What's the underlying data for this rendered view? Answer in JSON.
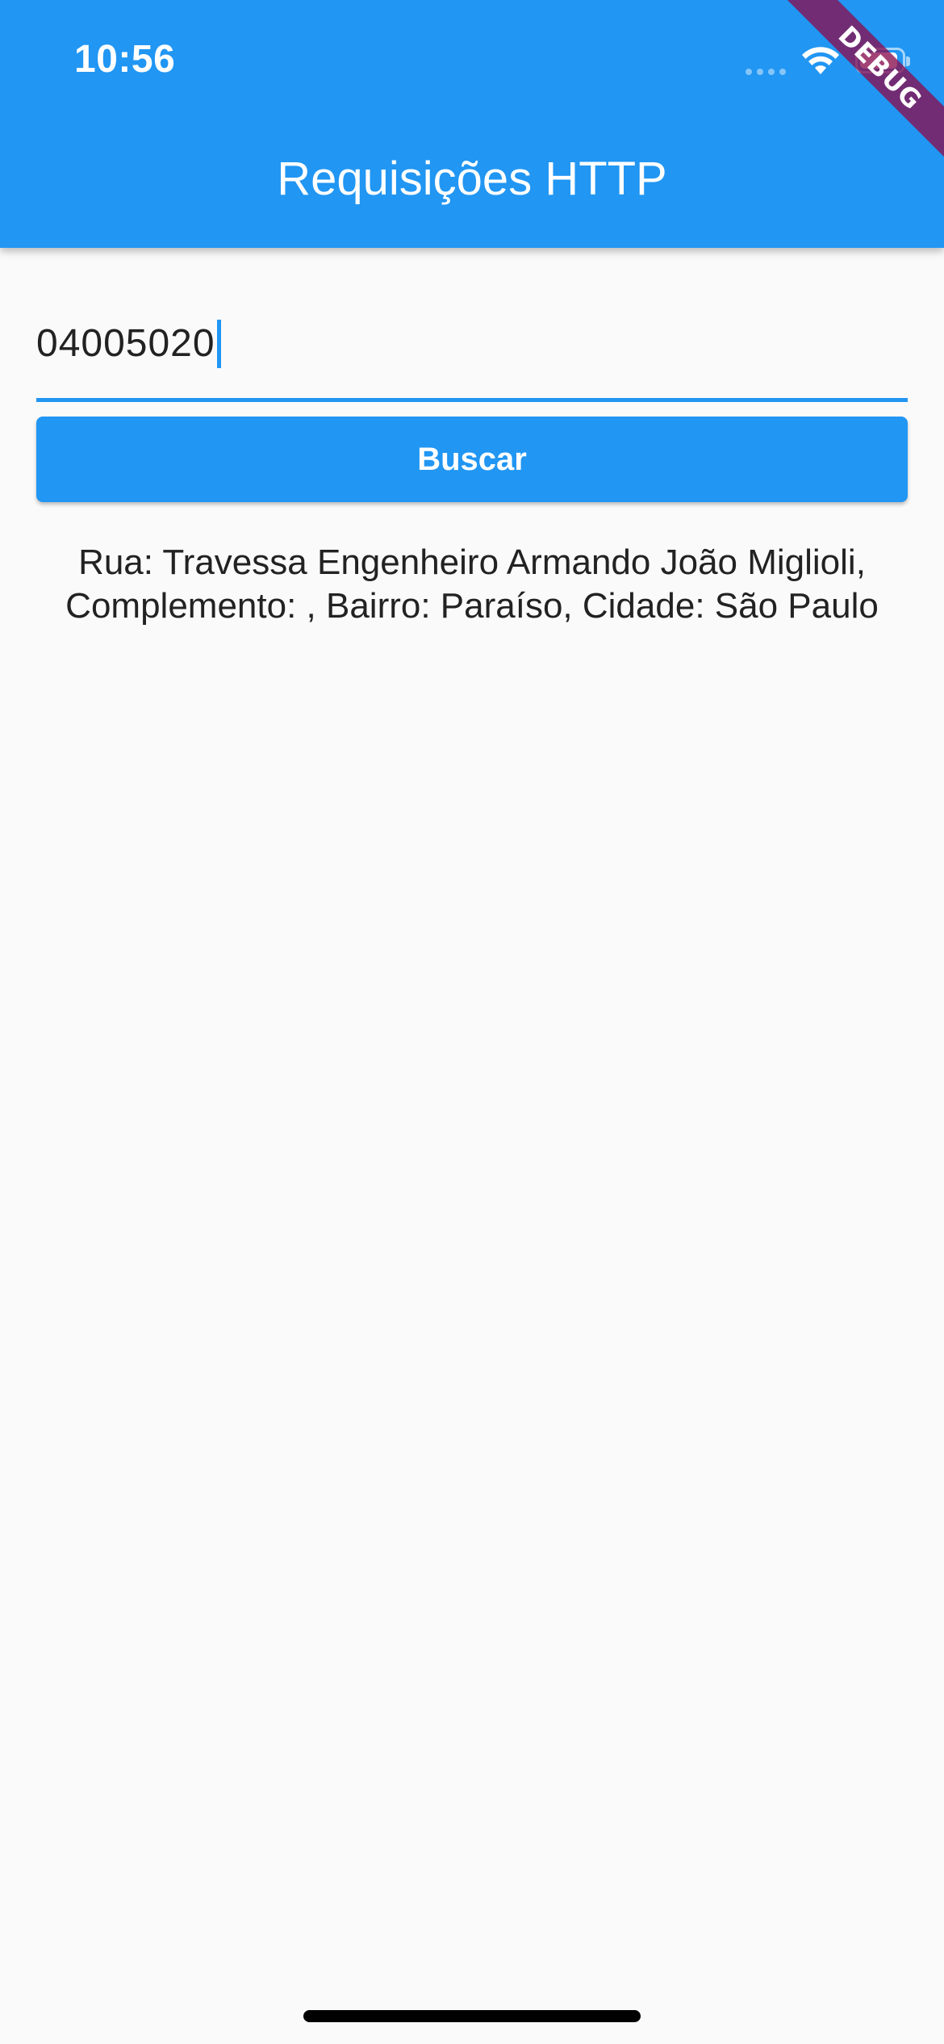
{
  "status_bar": {
    "time": "10:56",
    "icons": [
      "cellular-signal-icon",
      "wifi-icon",
      "battery-icon"
    ]
  },
  "debug_banner": "DEBUG",
  "app_bar": {
    "title": "Requisições HTTP"
  },
  "form": {
    "cep_value": "04005020",
    "search_button_label": "Buscar"
  },
  "result": {
    "text": "Rua: Travessa Engenheiro Armando João Miglioli, Complemento: , Bairro: Paraíso, Cidade: São Paulo"
  },
  "colors": {
    "primary": "#2196f3",
    "background": "#fafafa",
    "text": "#222222",
    "debug_banner": "#880e4f"
  }
}
